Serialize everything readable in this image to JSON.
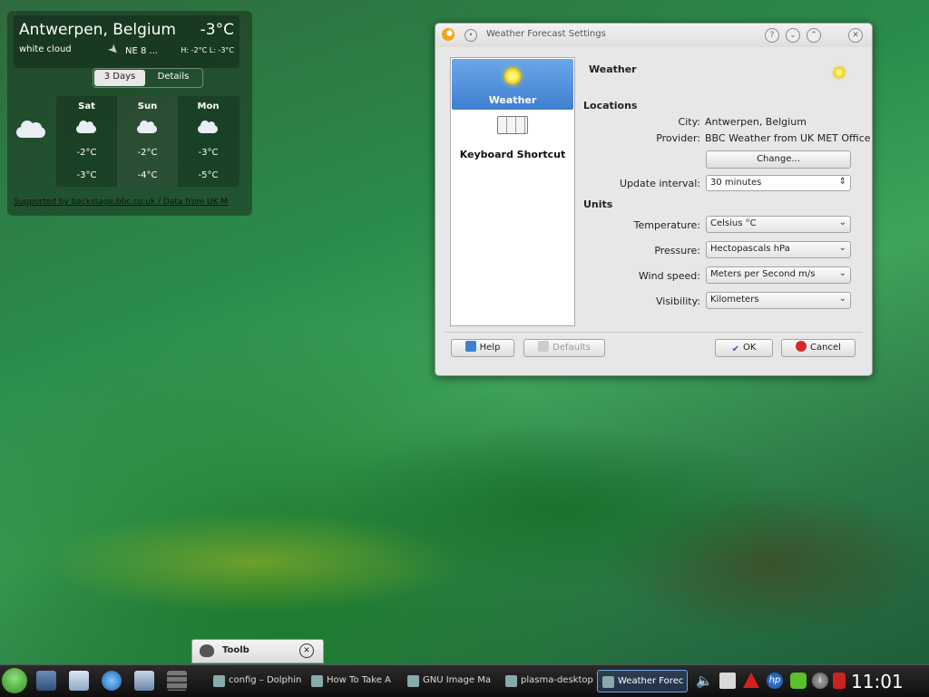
{
  "weather_widget": {
    "city": "Antwerpen, Belgium",
    "temperature": "-3°C",
    "condition": "white cloud",
    "wind": "NE 8 ...",
    "high_low": "H: -2°C L: -3°C",
    "tabs": [
      "3 Days",
      "Details"
    ],
    "days": [
      {
        "name": "Sat",
        "high": "-2°C",
        "low": "-3°C"
      },
      {
        "name": "Sun",
        "high": "-2°C",
        "low": "-4°C"
      },
      {
        "name": "Mon",
        "high": "-3°C",
        "low": "-5°C"
      }
    ],
    "credit": "Supported by backstage.bbc.co.uk / Data from UK M"
  },
  "dialog": {
    "title": "Weather Forecast Settings",
    "titlebar_buttons": [
      "?",
      "⌄",
      "⌃",
      "✕"
    ],
    "sidebar": [
      {
        "label": "Weather",
        "icon": "sun-icon"
      },
      {
        "label": "Keyboard Shortcut",
        "icon": "keyboard-icon"
      }
    ],
    "pane_title": "Weather",
    "locations_heading": "Locations",
    "city_label": "City:",
    "city_value": "Antwerpen, Belgium",
    "provider_label": "Provider:",
    "provider_value": "BBC Weather from UK MET Office",
    "change_button": "Change...",
    "update_label": "Update interval:",
    "update_value": "30 minutes",
    "units_heading": "Units",
    "temperature_label": "Temperature:",
    "temperature_value": "Celsius °C",
    "pressure_label": "Pressure:",
    "pressure_value": "Hectopascals hPa",
    "wind_label": "Wind speed:",
    "wind_value": "Meters per Second m/s",
    "visibility_label": "Visibility:",
    "visibility_value": "Kilometers",
    "help_button": "Help",
    "defaults_button": "Defaults",
    "ok_button": "OK",
    "cancel_button": "Cancel"
  },
  "toolbox": {
    "title": "Toolb"
  },
  "taskbar": {
    "tasks": [
      "config – Dolphin",
      "How To Take A",
      "GNU Image Ma",
      "plasma-desktop",
      "Weather Forec"
    ],
    "clock": "11:01"
  }
}
